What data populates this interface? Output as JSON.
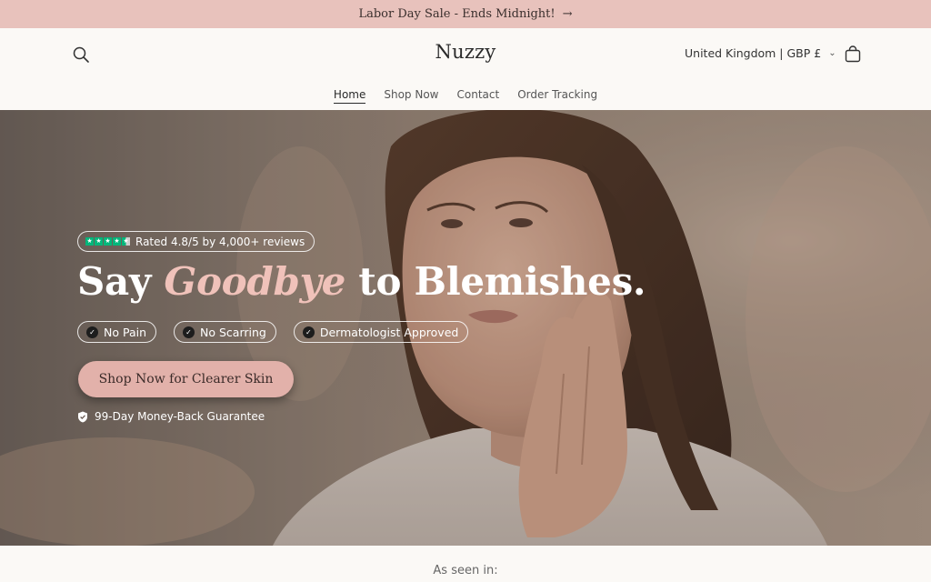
{
  "announcement": {
    "text": "Labor Day Sale - Ends Midnight!",
    "arrow": "→"
  },
  "header": {
    "logo": "Nuzzy",
    "locale": "United Kingdom | GBP £",
    "locale_chevron": "⌄",
    "icons": {
      "search": "search-icon",
      "cart": "cart-icon"
    }
  },
  "nav": {
    "items": [
      {
        "label": "Home",
        "active": true
      },
      {
        "label": "Shop Now",
        "active": false
      },
      {
        "label": "Contact",
        "active": false
      },
      {
        "label": "Order Tracking",
        "active": false
      }
    ]
  },
  "hero": {
    "rating": {
      "stars": 4.5,
      "text": "Rated 4.8/5 by 4,000+ reviews"
    },
    "headline": {
      "pre": "Say ",
      "highlight": "Goodbye",
      "post": " to Blemishes."
    },
    "badges": [
      "No Pain",
      "No Scarring",
      "Dermatologist Approved"
    ],
    "cta": "Shop Now for Clearer Skin",
    "guarantee": "99-Day Money-Back Guarantee"
  },
  "seen_in": {
    "label": "As seen in:"
  },
  "colors": {
    "announcement_bg": "#e8c2bc",
    "accent_pink": "#f0c2ba",
    "cta_bg": "#e2b1aa",
    "trustpilot_green": "#00b67a",
    "page_bg": "#fbf9f6"
  }
}
